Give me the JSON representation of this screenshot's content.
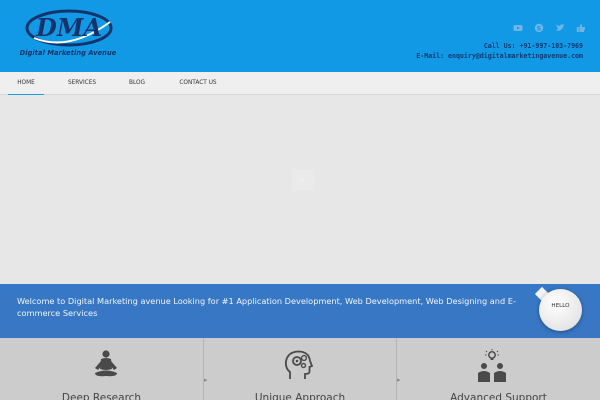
{
  "logo": {
    "mark": "DMA",
    "tagline": "Digital Marketing Avenue"
  },
  "social": [
    {
      "icon": "youtube-icon"
    },
    {
      "icon": "skype-icon"
    },
    {
      "icon": "twitter-icon"
    },
    {
      "icon": "like-icon"
    }
  ],
  "contact": {
    "phone": "Call Us: +91-997-103-7969",
    "email": "E-Mail: enquiry@digitalmarketingavenue.com"
  },
  "nav": {
    "items": [
      {
        "label": "HOME",
        "active": true
      },
      {
        "label": "SERVICES",
        "active": false
      },
      {
        "label": "BLOG",
        "active": false
      },
      {
        "label": "CONTACT US",
        "active": false
      }
    ]
  },
  "slider": {
    "arrow_icon": "chevron-left-icon"
  },
  "welcome": {
    "text": "Welcome to Digital Marketing avenue Looking for #1 Application Development, Web Development, Web Designing and E-commerce Services",
    "badge": "HELLO"
  },
  "features": [
    {
      "title": "Deep Research",
      "icon": "meditation-icon"
    },
    {
      "title": "Unique Approach",
      "icon": "brain-gear-icon"
    },
    {
      "title": "Advanced Support",
      "icon": "team-idea-icon"
    }
  ],
  "colors": {
    "header_bg": "#1199e6",
    "logo_navy": "#13336b",
    "banner_blue": "#3678c6",
    "nav_active": "#1e9be4"
  }
}
